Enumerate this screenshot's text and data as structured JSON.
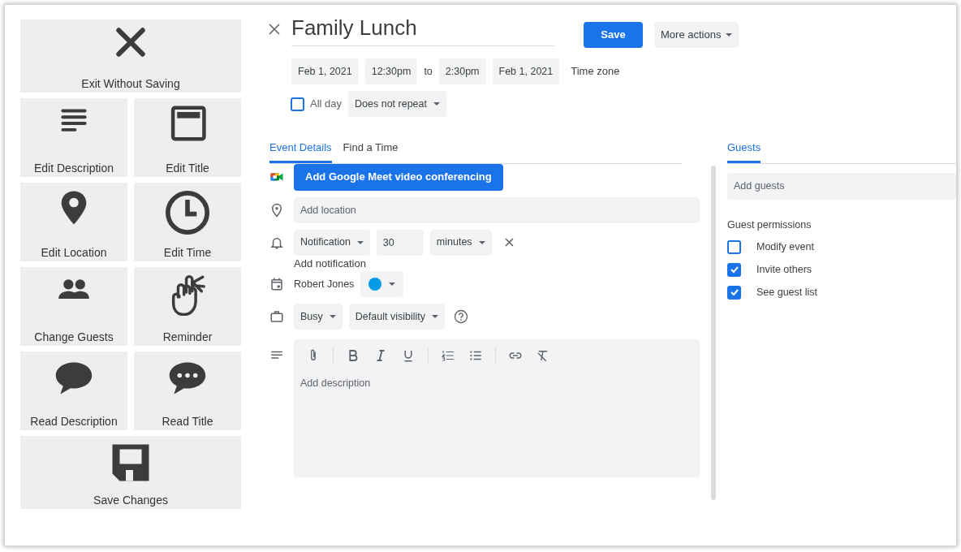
{
  "command_panel": {
    "rows": [
      [
        {
          "label": "Exit Without Saving"
        }
      ],
      [
        {
          "label": "Edit Description"
        },
        {
          "label": "Edit Title"
        }
      ],
      [
        {
          "label": "Edit Location"
        },
        {
          "label": "Edit Time"
        }
      ],
      [
        {
          "label": "Change Guests"
        },
        {
          "label": "Reminder"
        }
      ],
      [
        {
          "label": "Read Description"
        },
        {
          "label": "Read Title"
        }
      ],
      [
        {
          "label": "Save Changes"
        }
      ]
    ]
  },
  "event_editor": {
    "title": "Family Lunch",
    "save_button": "Save",
    "more_actions": "More actions",
    "start_date": "Feb 1, 2021",
    "start_time": "12:30pm",
    "to": "to",
    "end_time": "2:30pm",
    "end_date": "Feb 1, 2021",
    "time_zone": "Time zone",
    "all_day": {
      "label": "All day",
      "checked": false
    },
    "repeat": "Does not repeat",
    "tabs": [
      {
        "label": "Event Details",
        "selected": true
      },
      {
        "label": "Find a Time",
        "selected": false
      }
    ],
    "meet_button": "Add Google Meet video conferencing",
    "location": {
      "placeholder": "Add location"
    },
    "notification": {
      "type": "Notification",
      "value": "30",
      "unit": "minutes"
    },
    "add_notification": "Add notification",
    "calendar": {
      "owner": "Robert Jones",
      "color": "#039be5"
    },
    "availability": "Busy",
    "visibility": "Default visibility",
    "description": {
      "placeholder": "Add description"
    }
  },
  "guests_panel": {
    "tab": {
      "label": "Guests",
      "selected": true
    },
    "guests_field": {
      "placeholder": "Add guests"
    },
    "permissions_title": "Guest permissions",
    "permissions": [
      {
        "label": "Modify event",
        "checked": false
      },
      {
        "label": "Invite others",
        "checked": true
      },
      {
        "label": "See guest list",
        "checked": true
      }
    ]
  }
}
